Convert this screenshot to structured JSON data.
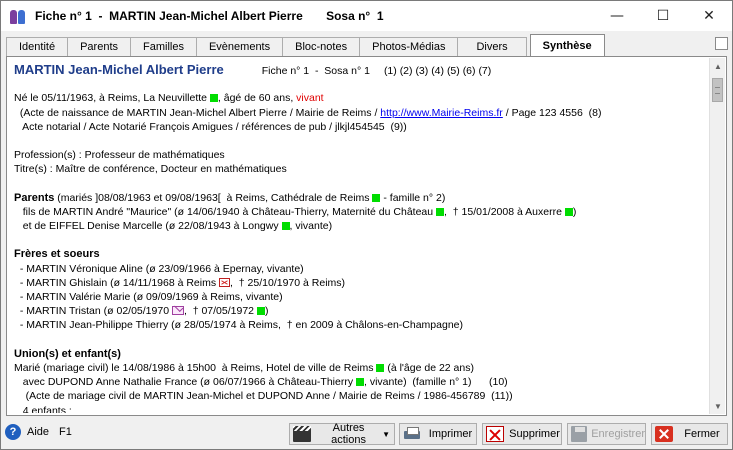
{
  "window": {
    "title": "Fiche n° 1  -  MARTIN Jean-Michel Albert Pierre       Sosa n°  1",
    "minimize": "—",
    "maximize": "☐",
    "close": "✕"
  },
  "tabs": [
    {
      "label": "Identité"
    },
    {
      "label": "Parents"
    },
    {
      "label": "Familles"
    },
    {
      "label": "Evènements"
    },
    {
      "label": "Bloc-notes"
    },
    {
      "label": "Photos-Médias"
    },
    {
      "label": "Divers"
    },
    {
      "label": "Synthèse"
    }
  ],
  "synthese": {
    "name": "MARTIN Jean-Michel Albert Pierre",
    "fiche_info": "Fiche n° 1  -  Sosa n° 1",
    "fiche_refs": "(1) (2) (3) (4) (5) (6) (7)",
    "birth_a": "Né le 05/11/1963, à Reims, La Neuvillette ",
    "birth_b": ", âgé de 60 ans, ",
    "birth_vivant": "vivant",
    "birth_act_a": "  (Acte de naissance de MARTIN Jean-Michel Albert Pierre / Mairie de Reims / ",
    "birth_act_link": "http://www.Mairie-Reims.fr",
    "birth_act_b": " / Page 123 4556  (8)",
    "notarial": "   Acte notarial / Acte Notarié François Amigues / références de pub / jlkjl454545  (9))",
    "profession": "Profession(s) : Professeur de mathématiques",
    "titres": "Titre(s) : Maître de conférence, Docteur en mathématiques",
    "parents_label": "Parents",
    "parents_a": " (mariés ]08/08/1963 et 09/08/1963[  à Reims, Cathédrale de Reims ",
    "parents_b": " - famille n° 2)",
    "father_a": "   fils de MARTIN André \"Maurice\" (ø 14/06/1940 à Château-Thierry, Maternité du Château ",
    "father_b": ",  † 15/01/2008 à Auxerre ",
    "father_c": ")",
    "mother_a": "   et de EIFFEL Denise Marcelle (ø 22/08/1943 à Longwy ",
    "mother_b": ", vivante)",
    "siblings_label": "Frères et soeurs",
    "sib1": "  - MARTIN Véronique Aline (ø 23/09/1966 à Epernay, vivante)",
    "sib2_a": "  - MARTIN Ghislain (ø 14/11/1968 à Reims ",
    "sib2_b": ",  † 25/10/1970 à Reims)",
    "sib3": "  - MARTIN Valérie Marie (ø 09/09/1969 à Reims, vivante)",
    "sib4_a": "  - MARTIN Tristan (ø 02/05/1970 ",
    "sib4_b": ",  † 07/05/1972 ",
    "sib4_c": ")",
    "sib5": "  - MARTIN Jean-Philippe Thierry (ø 28/05/1974 à Reims,  † en 2009 à Châlons-en-Champagne)",
    "unions_label": "Union(s) et enfant(s)",
    "union_a": "Marié (mariage civil) le 14/08/1986 à 15h00  à Reims, Hotel de ville de Reims ",
    "union_b": " (à l'âge de 22 ans)",
    "spouse_a": "   avec DUPOND Anne Nathalie France (ø 06/07/1966 à Château-Thierry ",
    "spouse_b": ", vivante)  (famille n° 1)      (10)",
    "marriage_act": "    (Acte de mariage civil de MARTIN Jean-Michel et DUPOND Anne / Mairie de Reims / 1986-456789  (11))",
    "children": "   4 enfants :"
  },
  "bottom": {
    "help_label": "Aide",
    "help_key": "F1",
    "help_icon_glyph": "?",
    "autres_actions": "Autres actions",
    "imprimer": "Imprimer",
    "supprimer": "Supprimer",
    "enregistrer": "Enregistrer",
    "fermer": "Fermer"
  }
}
